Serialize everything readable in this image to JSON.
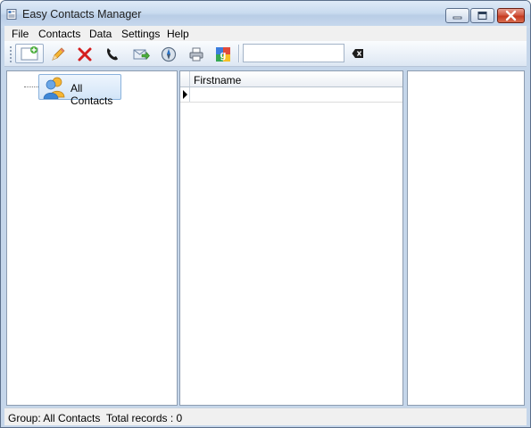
{
  "window": {
    "title": "Easy Contacts Manager"
  },
  "menu": {
    "items": [
      "File",
      "Contacts",
      "Data",
      "Settings",
      "Help"
    ]
  },
  "toolbar": {
    "buttons": [
      {
        "name": "new-contact",
        "icon": "new-contact-icon"
      },
      {
        "name": "edit-contact",
        "icon": "pencil-icon"
      },
      {
        "name": "delete-contact",
        "icon": "red-x-icon"
      },
      {
        "name": "call",
        "icon": "phone-icon"
      },
      {
        "name": "send-email",
        "icon": "email-send-icon"
      },
      {
        "name": "map",
        "icon": "compass-icon"
      },
      {
        "name": "print",
        "icon": "printer-icon"
      },
      {
        "name": "google-sync",
        "icon": "google-icon"
      }
    ],
    "search": {
      "value": "",
      "placeholder": ""
    },
    "clear_icon": "backspace-icon"
  },
  "tree": {
    "root": {
      "label": "All Contacts",
      "icon": "contacts-group-icon"
    }
  },
  "grid": {
    "columns": [
      "Firstname"
    ],
    "rows": []
  },
  "status": {
    "text": "Group: All Contacts  Total records : 0"
  },
  "colors": {
    "chrome": "#c5d6ea",
    "accent": "#8ab2dc",
    "close": "#c53a21"
  }
}
